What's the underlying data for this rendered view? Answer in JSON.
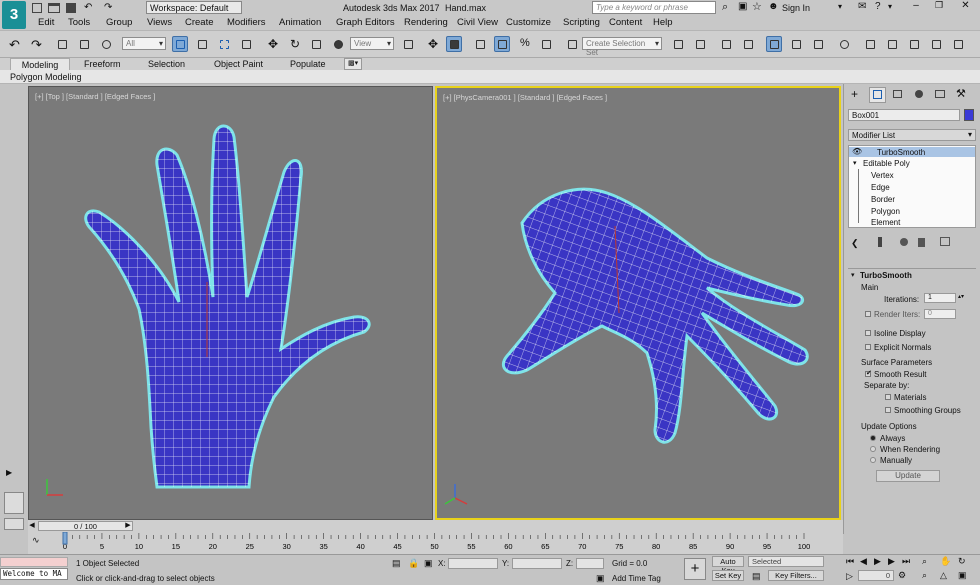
{
  "app": {
    "logo_text": "3",
    "workspace_label": "Workspace: Default",
    "window_title": "Autodesk 3ds Max 2017",
    "file_name": "Hand.max",
    "search_placeholder": "Type a keyword or phrase",
    "sign_in": "Sign In"
  },
  "menu": [
    "Edit",
    "Tools",
    "Group",
    "Views",
    "Create",
    "Modifiers",
    "Animation",
    "Graph Editors",
    "Rendering",
    "Civil View",
    "Customize",
    "Scripting",
    "Content",
    "Help"
  ],
  "toolbar": {
    "selection_filter": "All",
    "ref_coord": "View",
    "named_selection": "Create Selection Set"
  },
  "ribbon": {
    "tabs": [
      "Modeling",
      "Freeform",
      "Selection",
      "Object Paint",
      "Populate"
    ],
    "active_tab": "Modeling",
    "sub_label": "Polygon Modeling"
  },
  "viewports": {
    "left_label": "[+] [Top ] [Standard ] [Edged Faces ]",
    "right_label": "[+] [PhysCamera001 ] [Standard ] [Edged Faces ]"
  },
  "command_panel": {
    "object_name": "Box001",
    "object_color": "#3a3ad6",
    "modifier_list": "Modifier List",
    "stack": [
      {
        "label": "TurboSmooth",
        "indent": 0
      },
      {
        "label": "Editable Poly",
        "indent": 0
      },
      {
        "label": "Vertex",
        "indent": 1
      },
      {
        "label": "Edge",
        "indent": 1
      },
      {
        "label": "Border",
        "indent": 1
      },
      {
        "label": "Polygon",
        "indent": 1
      },
      {
        "label": "Element",
        "indent": 1
      }
    ],
    "rollout": {
      "title": "TurboSmooth",
      "main_label": "Main",
      "iterations_label": "Iterations:",
      "iterations_value": "1",
      "render_iters_label": "Render Iters:",
      "render_iters_value": "0",
      "isoline_display": "Isoline Display",
      "explicit_normals": "Explicit Normals",
      "surface_params": "Surface Parameters",
      "smooth_result": "Smooth Result",
      "separate_by": "Separate by:",
      "materials": "Materials",
      "smoothing_groups": "Smoothing Groups",
      "update_options": "Update Options",
      "always": "Always",
      "when_rendering": "When Rendering",
      "manually": "Manually",
      "update_button": "Update"
    }
  },
  "timeline": {
    "slider_label": "0 / 100",
    "ticks": [
      "0",
      "5",
      "10",
      "15",
      "20",
      "25",
      "30",
      "35",
      "40",
      "45",
      "50",
      "55",
      "60",
      "65",
      "70",
      "75",
      "80",
      "85",
      "90",
      "95",
      "100"
    ]
  },
  "status": {
    "maxscript": "Welcome to MA",
    "selected": "1 Object Selected",
    "prompt": "Click or click-and-drag to select objects",
    "x_label": "X:",
    "y_label": "Y:",
    "z_label": "Z:",
    "grid": "Grid = 0.0",
    "add_time_tag": "Add Time Tag",
    "auto_key": "Auto Key",
    "set_key": "Set Key",
    "selected_dropdown": "Selected",
    "key_filters": "Key Filters...",
    "frame": "0"
  },
  "colors": {
    "accent_blue": "#7fa9d6",
    "viewport_active": "#e8d21a",
    "mesh_fill": "#3a35c4",
    "mesh_wire": "#ffffff",
    "mesh_outline": "#7fe3e8"
  }
}
